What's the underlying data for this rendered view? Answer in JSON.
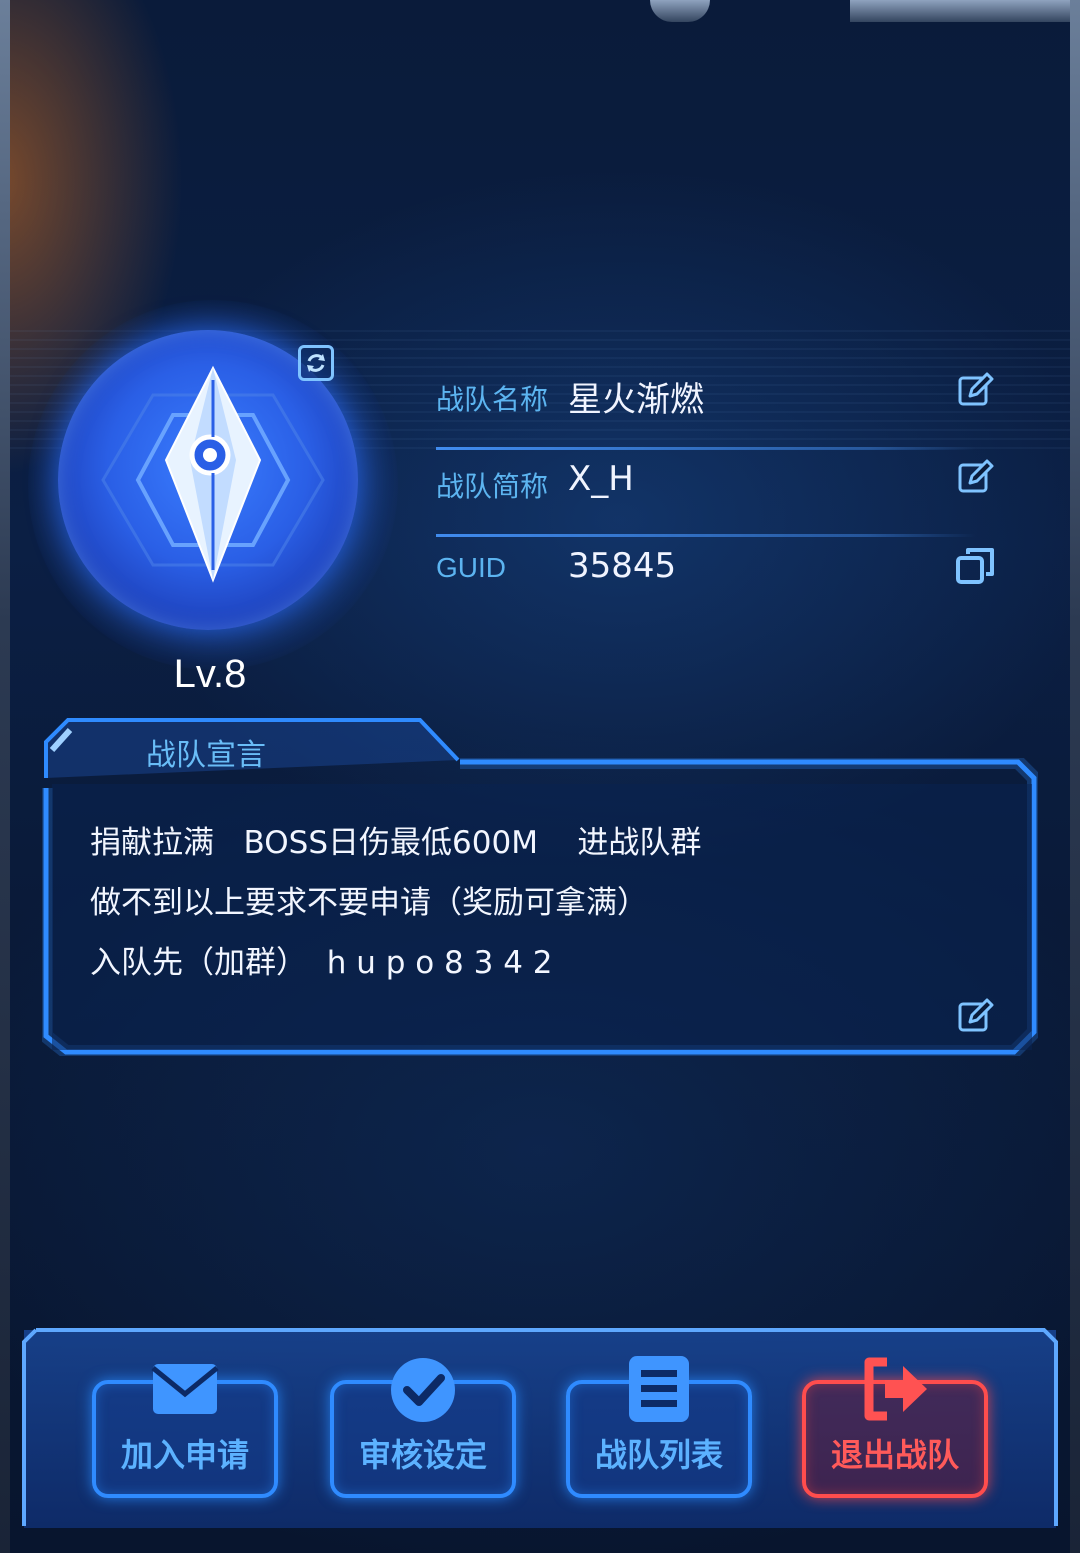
{
  "team_info": {
    "name_label": "战队名称",
    "name_value": "星火渐燃",
    "short_label": "战队简称",
    "short_value": "X_H",
    "guid_label": "GUID",
    "guid_value": "35845",
    "level": "Lv.8"
  },
  "declaration": {
    "title": "战队宣言",
    "lines": [
      "捐献拉满   BOSS日伤最低600M    进战队群",
      "做不到以上要求不要申请（奖励可拿满）",
      "入队先（加群）  h u p o 8 3 4 2"
    ]
  },
  "actions": {
    "join_requests": "加入申请",
    "review_settings": "审核设定",
    "team_list": "战队列表",
    "leave_team": "退出战队"
  },
  "icons": {
    "emblem": "diamond-crest-icon",
    "refresh": "refresh-icon",
    "edit": "edit-icon",
    "copy": "copy-icon",
    "mail": "mail-icon",
    "check": "check-icon",
    "list": "list-icon",
    "exit": "exit-icon"
  },
  "colors": {
    "accent_blue": "#2f8bff",
    "label_blue": "#5cb4f0",
    "danger_red": "#ff4d4d",
    "background": "#0a1b3a"
  }
}
